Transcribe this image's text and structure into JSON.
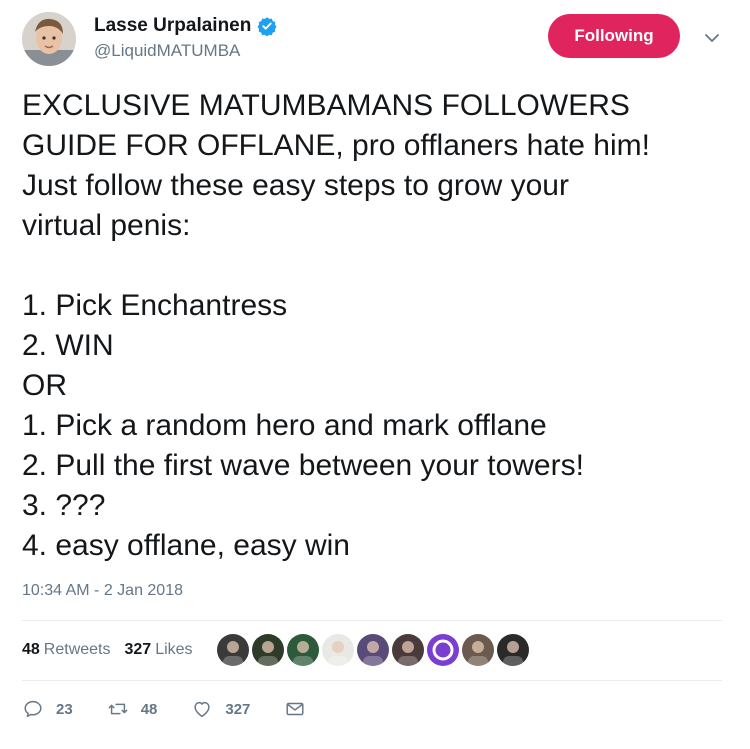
{
  "author": {
    "name": "Lasse Urpalainen",
    "handle": "@LiquidMATUMBA",
    "verified": true
  },
  "follow_button": {
    "label": "Following",
    "color": "#e0245e"
  },
  "tweet": {
    "lines": [
      "EXCLUSIVE MATUMBAMANS FOLLOWERS",
      "GUIDE FOR OFFLANE, pro offlaners hate him!",
      "Just follow these easy steps to grow your",
      "virtual penis:",
      "",
      "1. Pick Enchantress",
      "2. WIN",
      "OR",
      "1. Pick a random hero and mark offlane",
      "2. Pull the first wave between your towers!",
      "3. ???",
      "4. easy offlane, easy win"
    ],
    "timestamp": "10:34 AM - 2 Jan 2018"
  },
  "stats": {
    "retweets_count": "48",
    "retweets_label": "Retweets",
    "likes_count": "327",
    "likes_label": "Likes"
  },
  "likers": [
    {
      "name": "liker-1",
      "color": "#3a3a3a"
    },
    {
      "name": "liker-2",
      "color": "#2f3b2a"
    },
    {
      "name": "liker-3",
      "color": "#2c5a3a"
    },
    {
      "name": "liker-4",
      "color": "#e8e8e4"
    },
    {
      "name": "liker-5",
      "color": "#5a4a7a"
    },
    {
      "name": "liker-6",
      "color": "#4a3a3a"
    },
    {
      "name": "liker-7",
      "color": "#7a3fd0"
    },
    {
      "name": "liker-8",
      "color": "#6b5a4e"
    },
    {
      "name": "liker-9",
      "color": "#2a2a2a"
    }
  ],
  "actions": {
    "reply_count": "23",
    "retweet_count": "48",
    "like_count": "327"
  },
  "colors": {
    "accent_blue": "#1da1f2",
    "secondary_text": "#657786",
    "divider": "#e6ecf0"
  }
}
